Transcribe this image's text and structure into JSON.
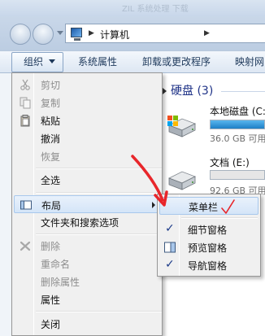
{
  "window": {
    "faded_title": "ZIL 系统处理 下载",
    "breadcrumb": "计算机",
    "breadcrumb_sep": "▶"
  },
  "toolbar": {
    "organize": "组织",
    "system_properties": "系统属性",
    "uninstall": "卸载或更改程序",
    "map_drive": "映射网"
  },
  "content": {
    "group_title": "硬盘 (3)",
    "drives": [
      {
        "name": "本地磁盘 (C:",
        "size": "36.0 GB 可用",
        "used_fraction": 1.0
      },
      {
        "name": "文档 (E:)",
        "size": "92.6 GB 可用",
        "used_fraction": 0.0
      }
    ]
  },
  "menu": {
    "items": [
      {
        "label": "剪切",
        "icon": "scissors-icon",
        "disabled": true
      },
      {
        "label": "复制",
        "icon": "copy-icon",
        "disabled": true
      },
      {
        "label": "粘贴",
        "icon": "paste-icon",
        "disabled": false
      },
      {
        "label": "撤消",
        "disabled": false
      },
      {
        "label": "恢复",
        "disabled": true
      },
      {
        "label": "全选",
        "disabled": false
      },
      {
        "label": "布局",
        "icon": "layout-icon",
        "disabled": false,
        "submenu": true
      },
      {
        "label": "文件夹和搜索选项",
        "disabled": false
      },
      {
        "label": "删除",
        "icon": "delete-x-icon",
        "disabled": true
      },
      {
        "label": "重命名",
        "disabled": true
      },
      {
        "label": "删除属性",
        "disabled": true
      },
      {
        "label": "属性",
        "disabled": false
      },
      {
        "label": "关闭",
        "disabled": false
      }
    ]
  },
  "submenu": {
    "items": [
      {
        "label": "菜单栏",
        "checked": false
      },
      {
        "label": "细节窗格",
        "checked": true
      },
      {
        "label": "预览窗格",
        "checked": false,
        "icon": "preview-pane-icon"
      },
      {
        "label": "导航窗格",
        "checked": true
      }
    ],
    "check_glyph": "✓"
  },
  "colors": {
    "annotation": "#e8262b",
    "accent": "#1e3287"
  }
}
